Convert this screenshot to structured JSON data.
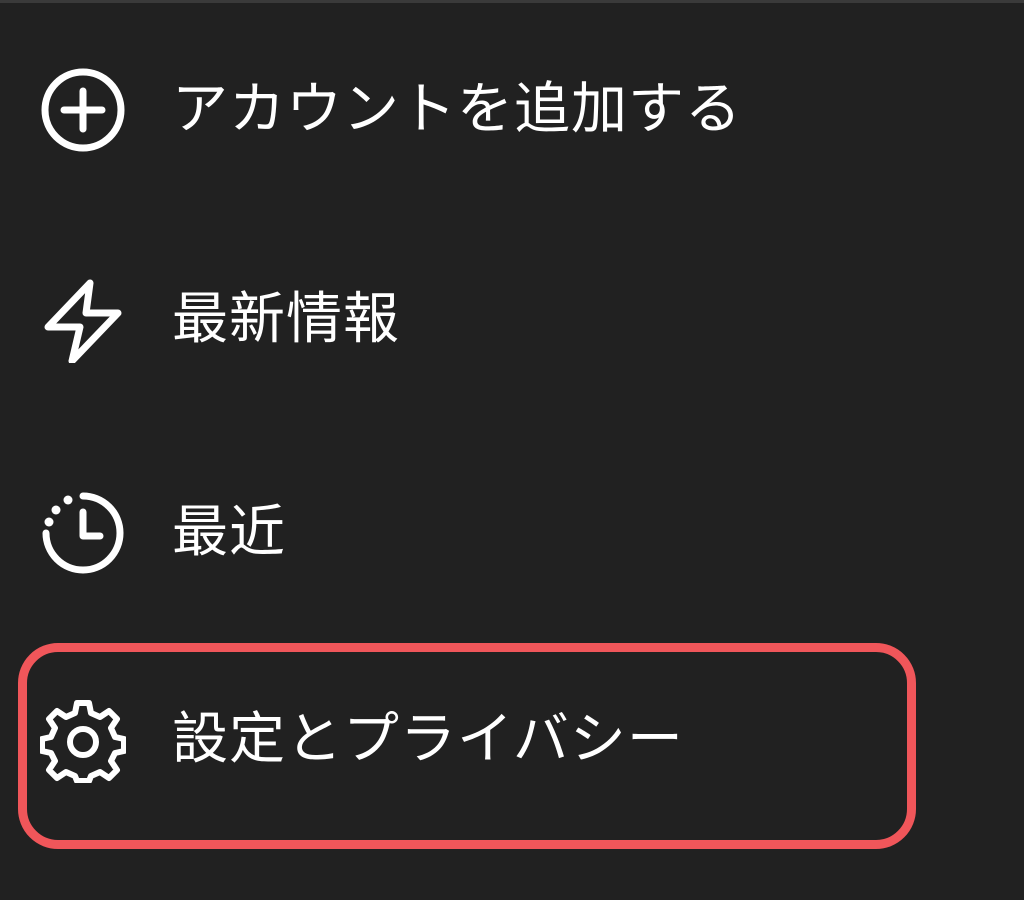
{
  "menu": {
    "items": [
      {
        "label": "アカウントを追加する",
        "icon": "add-circle-icon"
      },
      {
        "label": "最新情報",
        "icon": "lightning-bolt-icon"
      },
      {
        "label": "最近",
        "icon": "recent-clock-icon"
      },
      {
        "label": "設定とプライバシー",
        "icon": "gear-icon"
      }
    ]
  },
  "colors": {
    "background": "#212121",
    "text": "#ffffff",
    "highlight": "#f0565a"
  }
}
